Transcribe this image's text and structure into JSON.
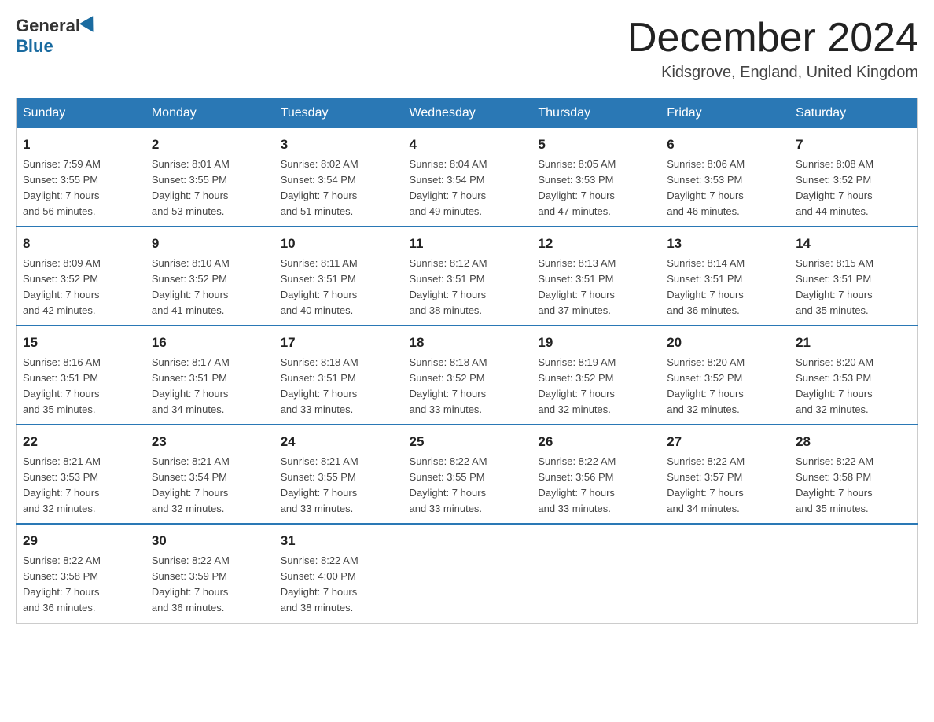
{
  "header": {
    "logo_general": "General",
    "logo_blue": "Blue",
    "month_title": "December 2024",
    "location": "Kidsgrove, England, United Kingdom"
  },
  "weekdays": [
    "Sunday",
    "Monday",
    "Tuesday",
    "Wednesday",
    "Thursday",
    "Friday",
    "Saturday"
  ],
  "weeks": [
    [
      {
        "day": "1",
        "sunrise": "7:59 AM",
        "sunset": "3:55 PM",
        "daylight": "7 hours and 56 minutes."
      },
      {
        "day": "2",
        "sunrise": "8:01 AM",
        "sunset": "3:55 PM",
        "daylight": "7 hours and 53 minutes."
      },
      {
        "day": "3",
        "sunrise": "8:02 AM",
        "sunset": "3:54 PM",
        "daylight": "7 hours and 51 minutes."
      },
      {
        "day": "4",
        "sunrise": "8:04 AM",
        "sunset": "3:54 PM",
        "daylight": "7 hours and 49 minutes."
      },
      {
        "day": "5",
        "sunrise": "8:05 AM",
        "sunset": "3:53 PM",
        "daylight": "7 hours and 47 minutes."
      },
      {
        "day": "6",
        "sunrise": "8:06 AM",
        "sunset": "3:53 PM",
        "daylight": "7 hours and 46 minutes."
      },
      {
        "day": "7",
        "sunrise": "8:08 AM",
        "sunset": "3:52 PM",
        "daylight": "7 hours and 44 minutes."
      }
    ],
    [
      {
        "day": "8",
        "sunrise": "8:09 AM",
        "sunset": "3:52 PM",
        "daylight": "7 hours and 42 minutes."
      },
      {
        "day": "9",
        "sunrise": "8:10 AM",
        "sunset": "3:52 PM",
        "daylight": "7 hours and 41 minutes."
      },
      {
        "day": "10",
        "sunrise": "8:11 AM",
        "sunset": "3:51 PM",
        "daylight": "7 hours and 40 minutes."
      },
      {
        "day": "11",
        "sunrise": "8:12 AM",
        "sunset": "3:51 PM",
        "daylight": "7 hours and 38 minutes."
      },
      {
        "day": "12",
        "sunrise": "8:13 AM",
        "sunset": "3:51 PM",
        "daylight": "7 hours and 37 minutes."
      },
      {
        "day": "13",
        "sunrise": "8:14 AM",
        "sunset": "3:51 PM",
        "daylight": "7 hours and 36 minutes."
      },
      {
        "day": "14",
        "sunrise": "8:15 AM",
        "sunset": "3:51 PM",
        "daylight": "7 hours and 35 minutes."
      }
    ],
    [
      {
        "day": "15",
        "sunrise": "8:16 AM",
        "sunset": "3:51 PM",
        "daylight": "7 hours and 35 minutes."
      },
      {
        "day": "16",
        "sunrise": "8:17 AM",
        "sunset": "3:51 PM",
        "daylight": "7 hours and 34 minutes."
      },
      {
        "day": "17",
        "sunrise": "8:18 AM",
        "sunset": "3:51 PM",
        "daylight": "7 hours and 33 minutes."
      },
      {
        "day": "18",
        "sunrise": "8:18 AM",
        "sunset": "3:52 PM",
        "daylight": "7 hours and 33 minutes."
      },
      {
        "day": "19",
        "sunrise": "8:19 AM",
        "sunset": "3:52 PM",
        "daylight": "7 hours and 32 minutes."
      },
      {
        "day": "20",
        "sunrise": "8:20 AM",
        "sunset": "3:52 PM",
        "daylight": "7 hours and 32 minutes."
      },
      {
        "day": "21",
        "sunrise": "8:20 AM",
        "sunset": "3:53 PM",
        "daylight": "7 hours and 32 minutes."
      }
    ],
    [
      {
        "day": "22",
        "sunrise": "8:21 AM",
        "sunset": "3:53 PM",
        "daylight": "7 hours and 32 minutes."
      },
      {
        "day": "23",
        "sunrise": "8:21 AM",
        "sunset": "3:54 PM",
        "daylight": "7 hours and 32 minutes."
      },
      {
        "day": "24",
        "sunrise": "8:21 AM",
        "sunset": "3:55 PM",
        "daylight": "7 hours and 33 minutes."
      },
      {
        "day": "25",
        "sunrise": "8:22 AM",
        "sunset": "3:55 PM",
        "daylight": "7 hours and 33 minutes."
      },
      {
        "day": "26",
        "sunrise": "8:22 AM",
        "sunset": "3:56 PM",
        "daylight": "7 hours and 33 minutes."
      },
      {
        "day": "27",
        "sunrise": "8:22 AM",
        "sunset": "3:57 PM",
        "daylight": "7 hours and 34 minutes."
      },
      {
        "day": "28",
        "sunrise": "8:22 AM",
        "sunset": "3:58 PM",
        "daylight": "7 hours and 35 minutes."
      }
    ],
    [
      {
        "day": "29",
        "sunrise": "8:22 AM",
        "sunset": "3:58 PM",
        "daylight": "7 hours and 36 minutes."
      },
      {
        "day": "30",
        "sunrise": "8:22 AM",
        "sunset": "3:59 PM",
        "daylight": "7 hours and 36 minutes."
      },
      {
        "day": "31",
        "sunrise": "8:22 AM",
        "sunset": "4:00 PM",
        "daylight": "7 hours and 38 minutes."
      },
      null,
      null,
      null,
      null
    ]
  ],
  "labels": {
    "sunrise": "Sunrise:",
    "sunset": "Sunset:",
    "daylight": "Daylight:"
  }
}
